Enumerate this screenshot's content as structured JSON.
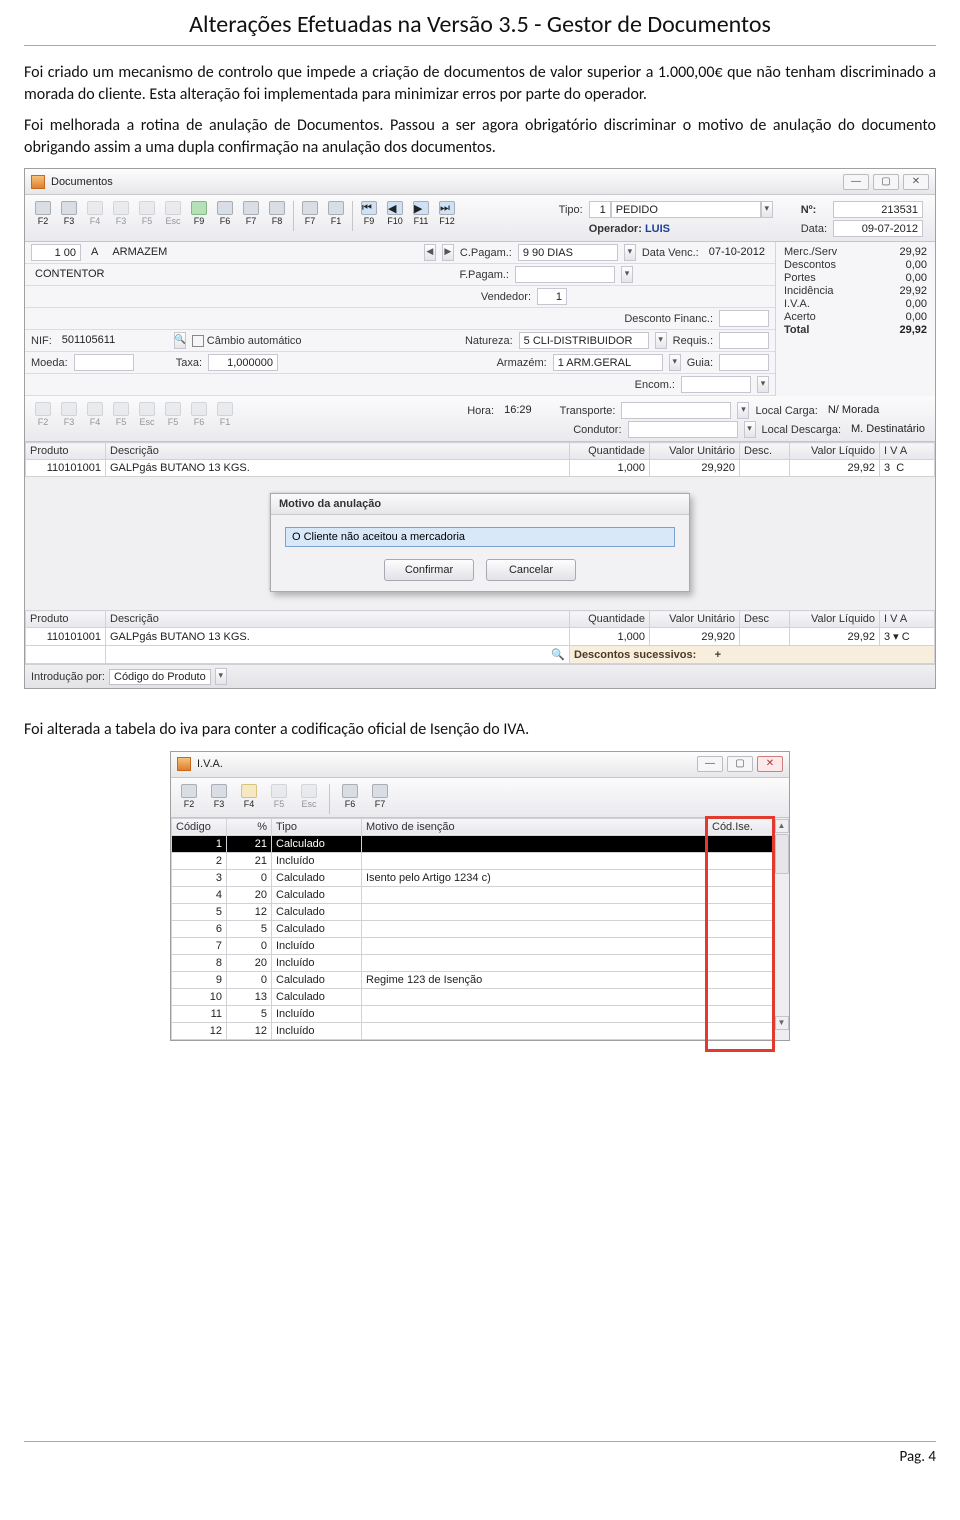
{
  "doc": {
    "title": "Alterações Efetuadas na Versão 3.5 - Gestor de Documentos",
    "para1": "Foi criado um mecanismo de controlo que impede a criação de documentos de valor superior a 1.000,00€ que não tenham discriminado a morada do cliente. Esta alteração foi implementada para minimizar erros por parte do operador.",
    "para2": "Foi melhorada a rotina de anulação de Documentos. Passou a ser agora obrigatório discriminar o motivo de anulação do documento obrigando assim a uma dupla confirmação na anulação dos documentos.",
    "para3": "Foi alterada a tabela do iva para conter a codificação oficial de Isenção do IVA.",
    "footer": "Pag. 4"
  },
  "shot1": {
    "window_title": "Documentos",
    "toolbar_top": [
      "F2",
      "F3",
      "F4",
      "F3",
      "F5",
      "Esc",
      "F9",
      "F6",
      "F7",
      "F8",
      "F7",
      "F1",
      "F9",
      "F10",
      "F11",
      "F12"
    ],
    "header": {
      "tipo_label": "Tipo:",
      "tipo_value": "1",
      "tipo_text": "PEDIDO",
      "num_label": "Nº:",
      "num_value": "213531",
      "operador_label": "Operador:",
      "operador_value": "LUIS",
      "data_label": "Data:",
      "data_value": "09-07-2012"
    },
    "row2": {
      "left1": "1 00",
      "left2": "A",
      "left3": "ARMAZEM",
      "cpag_label": "C.Pagam.:",
      "cpag_value": "9 90 DIAS",
      "dvenc_label": "Data Venc.:",
      "dvenc_value": "07-10-2012"
    },
    "row3": {
      "contentor": "CONTENTOR",
      "fpag_label": "F.Pagam.:",
      "vend_label": "Vendedor:",
      "vend_value": "1",
      "descfin_label": "Desconto Financ.:"
    },
    "row4": {
      "nif_label": "NIF:",
      "nif_value": "501105611",
      "cambio": "Câmbio automático",
      "natureza_label": "Natureza:",
      "natureza_value": "5 CLI-DISTRIBUIDOR",
      "armazem_label": "Armazém:",
      "armazem_value": "1 ARM.GERAL",
      "requis_label": "Requis.:",
      "guia_label": "Guia:"
    },
    "row5": {
      "moeda_label": "Moeda:",
      "taxa_label": "Taxa:",
      "taxa_value": "1,000000",
      "encom_label": "Encom.:"
    },
    "summary": {
      "merc_serv": {
        "k": "Merc./Serv",
        "v": "29,92"
      },
      "descontos": {
        "k": "Descontos",
        "v": "0,00"
      },
      "portes": {
        "k": "Portes",
        "v": "0,00"
      },
      "incidencia": {
        "k": "Incidência",
        "v": "29,92"
      },
      "iva": {
        "k": "I.V.A.",
        "v": "0,00"
      },
      "acerto": {
        "k": "Acerto",
        "v": "0,00"
      },
      "total": {
        "k": "Total",
        "v": "29,92"
      }
    },
    "toolbar_mid": [
      "F2",
      "F3",
      "F4",
      "F5",
      "Esc",
      "F5",
      "F6",
      "F1"
    ],
    "midrow": {
      "hora_label": "Hora:",
      "hora_value": "16:29",
      "transporte_label": "Transporte:",
      "condutor_label": "Condutor:",
      "local_carga_label": "Local Carga:",
      "local_carga_value": "N/ Morada",
      "local_desc_label": "Local Descarga:",
      "local_desc_value": "M. Destinatário"
    },
    "grid1_headers": [
      "Produto",
      "Descrição",
      "Quantidade",
      "Valor Unitário",
      "Desc.",
      "Valor Líquido",
      "I V A"
    ],
    "grid1_row": {
      "produto": "110101001",
      "descricao": "GALPgás BUTANO 13 KGS.",
      "quantidade": "1,000",
      "vu": "29,920",
      "desc": "",
      "vl": "29,92",
      "iva": "3",
      "suf": "C"
    },
    "modal": {
      "title": "Motivo da anulação",
      "value": "O Cliente não aceitou a mercadoria",
      "confirm": "Confirmar",
      "cancel": "Cancelar"
    },
    "grid2_headers": [
      "Produto",
      "Descrição",
      "Quantidade",
      "Valor Unitário",
      "Desc",
      "Valor Líquido",
      "I V A"
    ],
    "grid2_row": {
      "produto": "110101001",
      "descricao": "GALPgás BUTANO 13 KGS.",
      "quantidade": "1,000",
      "vu": "29,920",
      "desc": "",
      "vl": "29,92",
      "iva": "3",
      "suf": "C"
    },
    "descontos_sucessivos": {
      "label": "Descontos sucessivos:",
      "plus": "+"
    },
    "status": {
      "intro_label": "Introdução por:",
      "intro_value": "Código do Produto"
    }
  },
  "shot2": {
    "window_title": "I.V.A.",
    "toolbar": [
      "F2",
      "F3",
      "F4",
      "F5",
      "Esc",
      "F6",
      "F7"
    ],
    "headers": [
      "Código",
      "%",
      "Tipo",
      "Motivo de isenção",
      "Cód.Ise."
    ],
    "rows": [
      {
        "codigo": "1",
        "pct": "21",
        "tipo": "Calculado",
        "motivo": "",
        "cod": ""
      },
      {
        "codigo": "2",
        "pct": "21",
        "tipo": "Incluído",
        "motivo": "",
        "cod": ""
      },
      {
        "codigo": "3",
        "pct": "0",
        "tipo": "Calculado",
        "motivo": "Isento pelo Artigo 1234 c)",
        "cod": ""
      },
      {
        "codigo": "4",
        "pct": "20",
        "tipo": "Calculado",
        "motivo": "",
        "cod": ""
      },
      {
        "codigo": "5",
        "pct": "12",
        "tipo": "Calculado",
        "motivo": "",
        "cod": ""
      },
      {
        "codigo": "6",
        "pct": "5",
        "tipo": "Calculado",
        "motivo": "",
        "cod": ""
      },
      {
        "codigo": "7",
        "pct": "0",
        "tipo": "Incluído",
        "motivo": "",
        "cod": ""
      },
      {
        "codigo": "8",
        "pct": "20",
        "tipo": "Incluído",
        "motivo": "",
        "cod": ""
      },
      {
        "codigo": "9",
        "pct": "0",
        "tipo": "Calculado",
        "motivo": "Regime 123 de Isenção",
        "cod": ""
      },
      {
        "codigo": "10",
        "pct": "13",
        "tipo": "Calculado",
        "motivo": "",
        "cod": ""
      },
      {
        "codigo": "11",
        "pct": "5",
        "tipo": "Incluído",
        "motivo": "",
        "cod": ""
      },
      {
        "codigo": "12",
        "pct": "12",
        "tipo": "Incluído",
        "motivo": "",
        "cod": ""
      }
    ]
  }
}
